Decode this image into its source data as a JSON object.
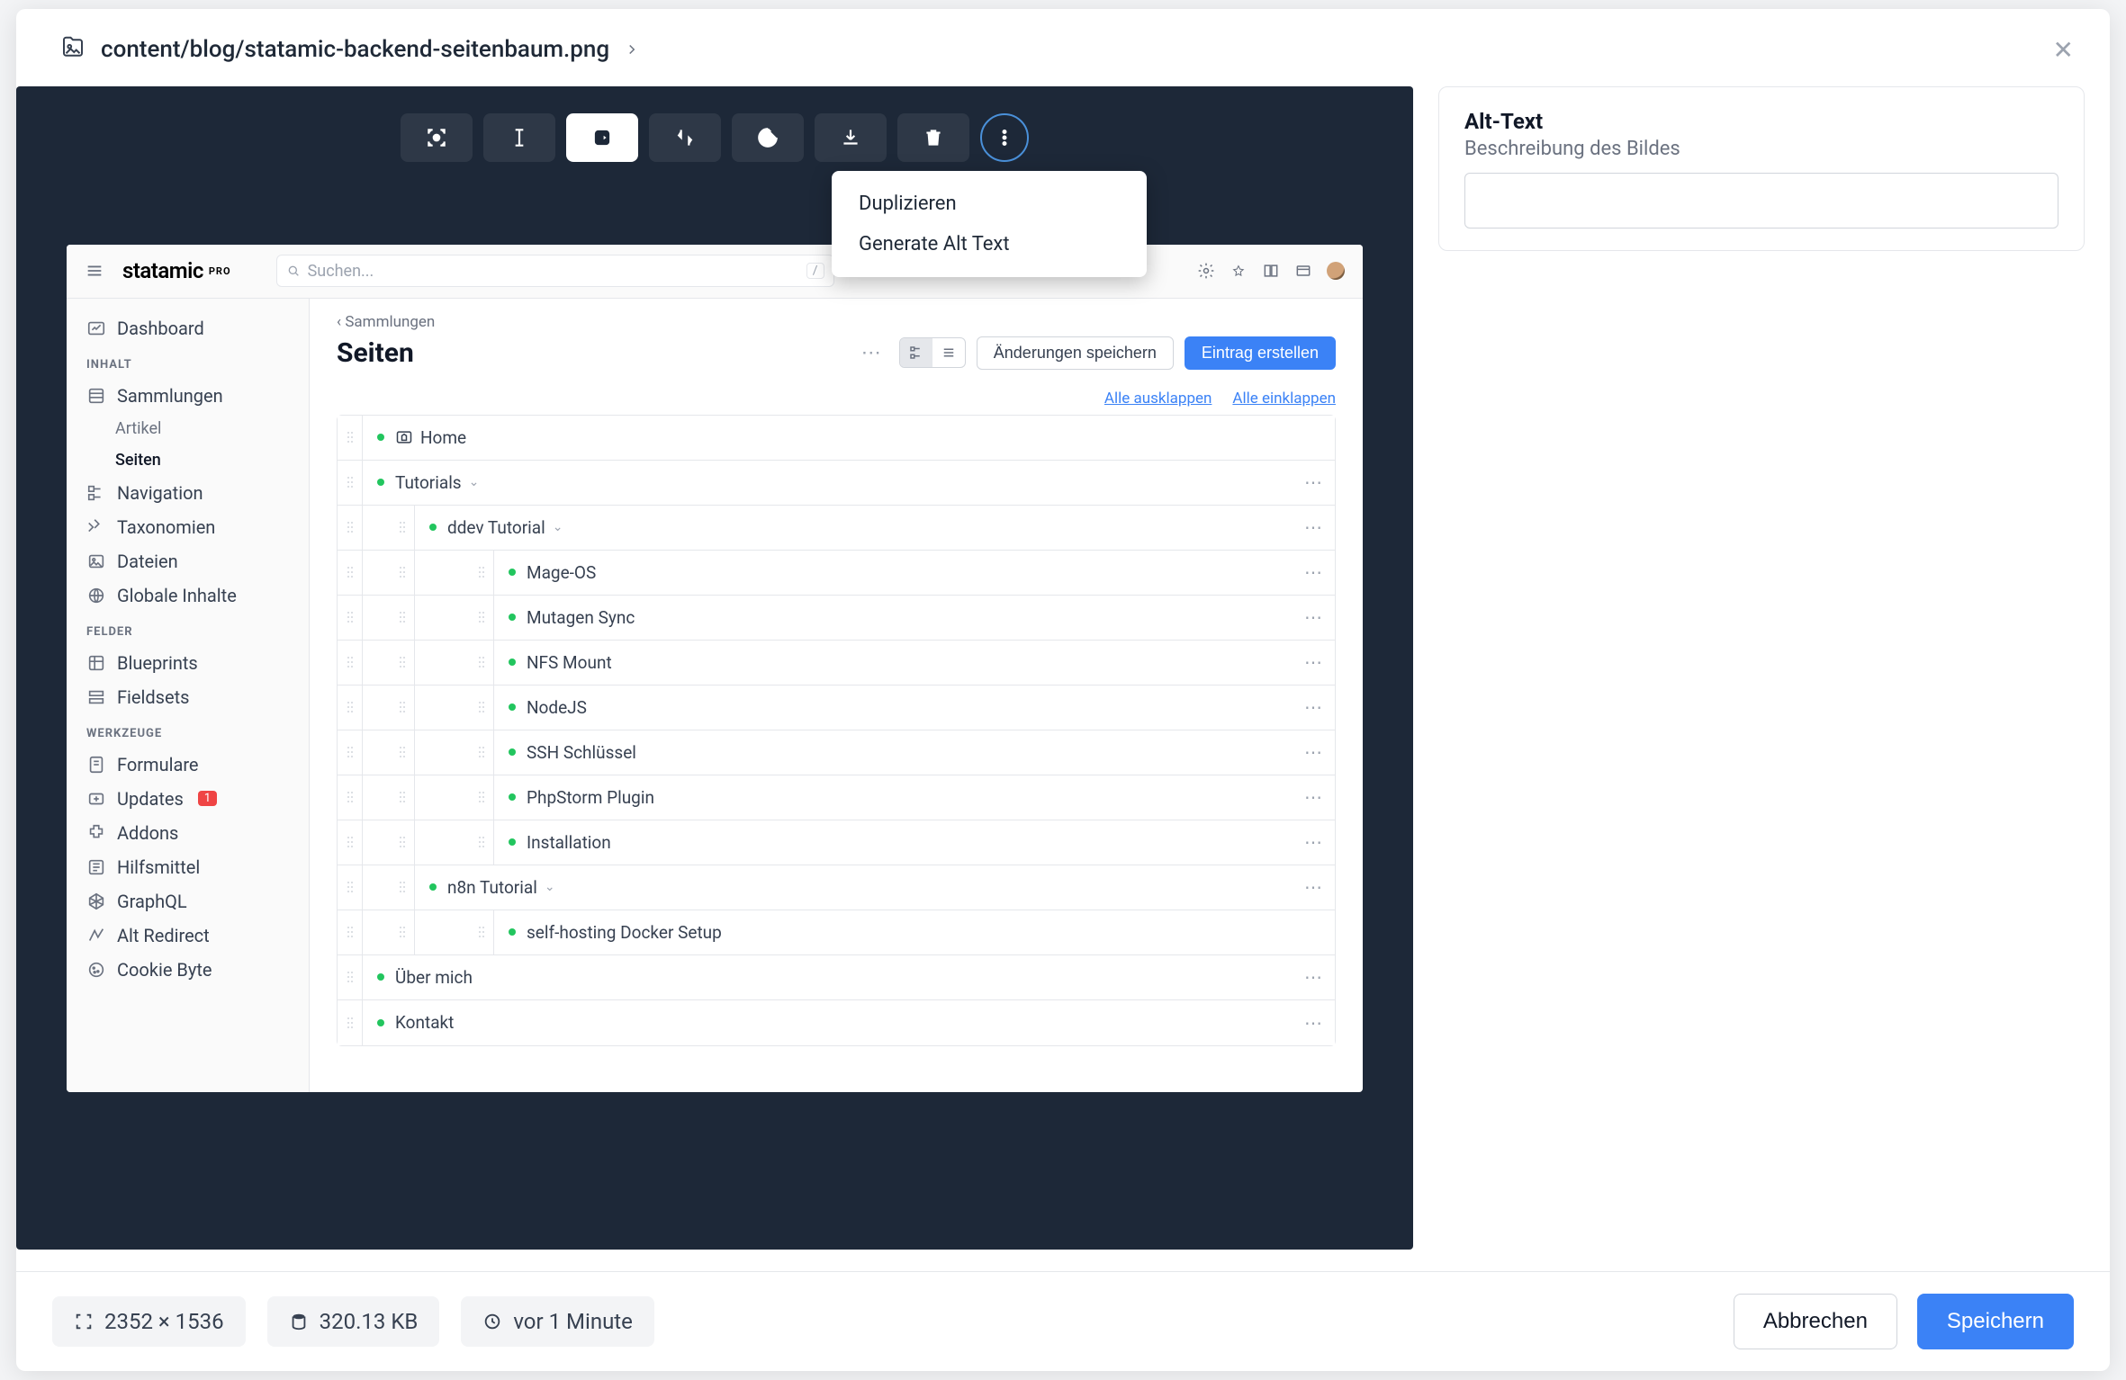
{
  "breadcrumb": "content/blog/statamic-backend-seitenbaum.png",
  "dropdown": {
    "duplicate": "Duplizieren",
    "gen_alt": "Generate Alt Text"
  },
  "side": {
    "alt_label": "Alt-Text",
    "alt_help": "Beschreibung des Bildes",
    "alt_value": ""
  },
  "footer": {
    "dimensions": "2352 × 1536",
    "size": "320.13 KB",
    "time": "vor 1 Minute",
    "cancel": "Abbrechen",
    "save": "Speichern"
  },
  "ss": {
    "logo": "statamic",
    "logo_suffix": "PRO",
    "search_placeholder": "Suchen...",
    "slash": "/",
    "nav": {
      "dashboard": "Dashboard",
      "g_inhalt": "INHALT",
      "sammlungen": "Sammlungen",
      "artikel": "Artikel",
      "seiten": "Seiten",
      "navigation": "Navigation",
      "taxonomien": "Taxonomien",
      "dateien": "Dateien",
      "globale": "Globale Inhalte",
      "g_felder": "FELDER",
      "blueprints": "Blueprints",
      "fieldsets": "Fieldsets",
      "g_werkzeuge": "WERKZEUGE",
      "formulare": "Formulare",
      "updates": "Updates",
      "updates_badge": "1",
      "addons": "Addons",
      "hilfsmittel": "Hilfsmittel",
      "graphql": "GraphQL",
      "altredirect": "Alt Redirect",
      "cookiebyte": "Cookie Byte"
    },
    "main": {
      "crumb": "‹  Sammlungen",
      "title": "Seiten",
      "save_changes": "Änderungen speichern",
      "create": "Eintrag erstellen",
      "expand_all": "Alle ausklappen",
      "collapse_all": "Alle einklappen"
    },
    "tree": [
      {
        "label": "Home",
        "level": 1,
        "home": true
      },
      {
        "label": "Tutorials",
        "level": 1,
        "expand": true,
        "dots": true
      },
      {
        "label": "ddev Tutorial",
        "level": 2,
        "expand": true,
        "dots": true
      },
      {
        "label": "Mage-OS",
        "level": 3,
        "dots": true
      },
      {
        "label": "Mutagen Sync",
        "level": 3,
        "dots": true
      },
      {
        "label": "NFS Mount",
        "level": 3,
        "dots": true
      },
      {
        "label": "NodeJS",
        "level": 3,
        "dots": true
      },
      {
        "label": "SSH Schlüssel",
        "level": 3,
        "dots": true
      },
      {
        "label": "PhpStorm Plugin",
        "level": 3,
        "dots": true
      },
      {
        "label": "Installation",
        "level": 3,
        "dots": true
      },
      {
        "label": "n8n Tutorial",
        "level": 2,
        "expand": true,
        "dots": true
      },
      {
        "label": "self-hosting Docker Setup",
        "level": 3
      },
      {
        "label": "Über mich",
        "level": 1,
        "dots": true
      },
      {
        "label": "Kontakt",
        "level": 1,
        "dots": true
      }
    ]
  }
}
